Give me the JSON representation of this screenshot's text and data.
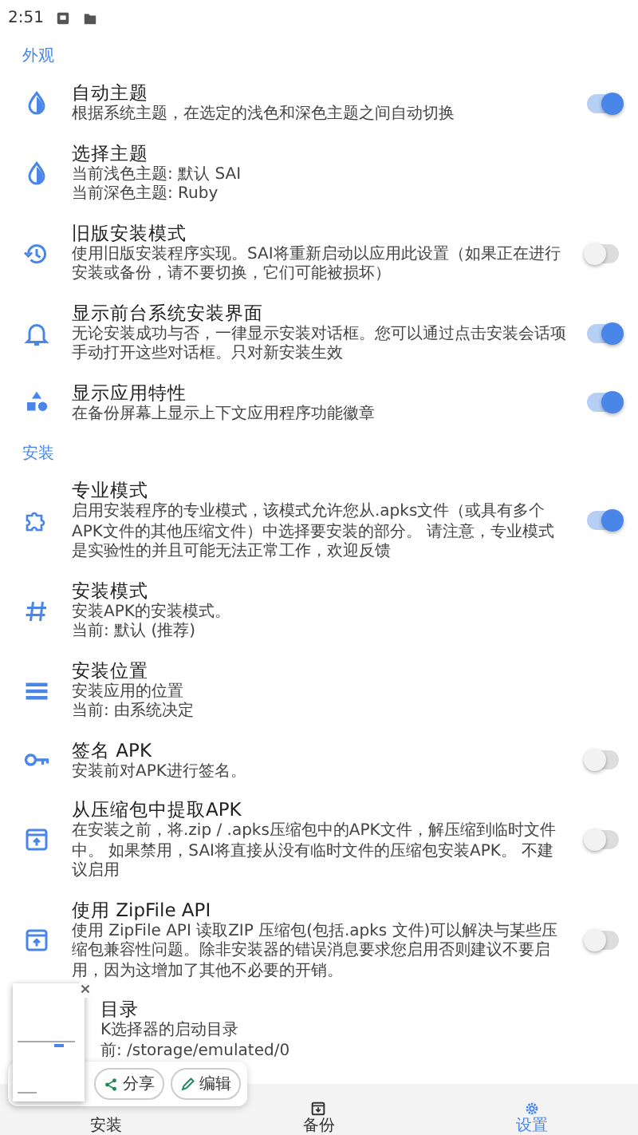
{
  "status_bar": {
    "time": "2:51"
  },
  "sections": [
    {
      "title": "外观",
      "items": [
        {
          "kind": "switch",
          "title": "自动主题",
          "lines": [
            "根据系统主题，在选定的浅色和深色主题之间自动切换"
          ],
          "on": true
        },
        {
          "kind": "plain",
          "title": "选择主题",
          "lines": [
            "当前浅色主题: 默认 SAI",
            "当前深色主题: Ruby"
          ]
        },
        {
          "kind": "switch",
          "title": "旧版安装模式",
          "lines": [
            "使用旧版安装程序实现。SAI将重新启动以应用此设置（如果正在进行安装或备份，请不要切换，它们可能被损坏）"
          ],
          "on": false
        },
        {
          "kind": "switch",
          "title": "显示前台系统安装界面",
          "lines": [
            "无论安装成功与否，一律显示安装对话框。您可以通过点击安装会话项手动打开这些对话框。只对新安装生效"
          ],
          "on": true
        },
        {
          "kind": "switch",
          "title": "显示应用特性",
          "lines": [
            "在备份屏幕上显示上下文应用程序功能徽章"
          ],
          "on": true
        }
      ]
    },
    {
      "title": "安装",
      "items": [
        {
          "kind": "switch",
          "title": "专业模式",
          "lines": [
            "启用安装程序的专业模式，该模式允许您从.apks文件（或具有多个APK文件的其他压缩文件）中选择要安装的部分。 请注意，专业模式是实验性的并且可能无法正常工作，欢迎反馈"
          ],
          "on": true
        },
        {
          "kind": "plain",
          "title": "安装模式",
          "lines": [
            "安装APK的安装模式。",
            "当前: 默认 (推荐)"
          ]
        },
        {
          "kind": "plain",
          "title": "安装位置",
          "lines": [
            "安装应用的位置",
            "当前: 由系统决定"
          ]
        },
        {
          "kind": "switch",
          "title": "签名 APK",
          "lines": [
            "安装前对APK进行签名。"
          ],
          "on": false
        },
        {
          "kind": "switch",
          "title": "从压缩包中提取APK",
          "lines": [
            "在安装之前，将.zip / .apks压缩包中的APK文件，解压缩到临时文件中。 如果禁用，SAI将直接从没有临时文件的压缩包安装APK。 不建议启用"
          ],
          "on": false
        },
        {
          "kind": "switch",
          "title": "使用 ZipFile API",
          "lines": [
            "使用 ZipFile API 读取ZIP 压缩包(包括.apks 文件)可以解决与某些压缩包兼容性问题。除非安装器的错误消息要求您启用否则建议不要启用，因为这增加了其他不必要的开销。"
          ],
          "on": false
        },
        {
          "kind": "covered",
          "title": "目录",
          "lines": [
            "K选择器的启动目录",
            "前: /storage/emulated/0"
          ]
        }
      ]
    }
  ],
  "bottom_nav": [
    {
      "label": "安装",
      "selected": false
    },
    {
      "label": "备份",
      "selected": false
    },
    {
      "label": "设置",
      "selected": true
    }
  ],
  "screenshot_preview": {
    "actions": [
      "分享",
      "编辑"
    ]
  }
}
